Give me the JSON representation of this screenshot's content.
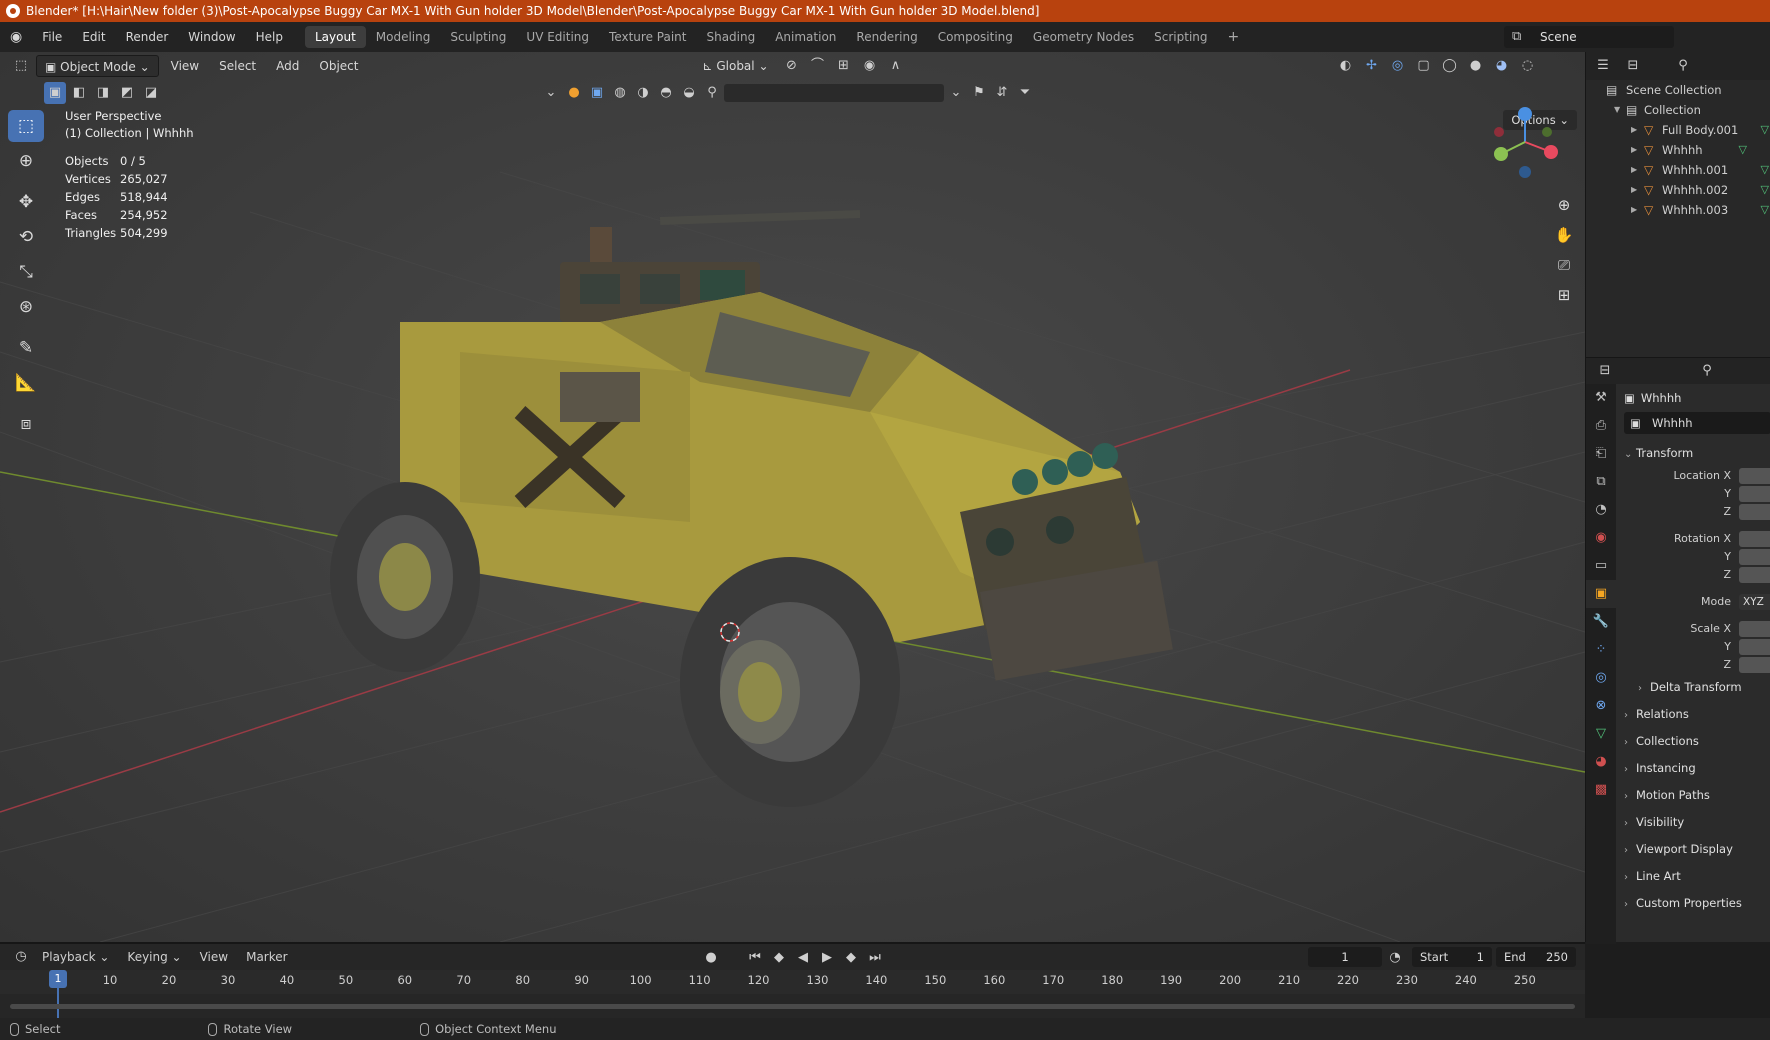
{
  "window": {
    "title": "Blender* [H:\\Hair\\New folder (3)\\Post-Apocalypse Buggy Car MX-1 With Gun holder 3D Model\\Blender\\Post-Apocalypse Buggy Car MX-1 With Gun holder 3D Model.blend]"
  },
  "menu": [
    "File",
    "Edit",
    "Render",
    "Window",
    "Help"
  ],
  "workspaces": [
    "Layout",
    "Modeling",
    "Sculpting",
    "UV Editing",
    "Texture Paint",
    "Shading",
    "Animation",
    "Rendering",
    "Compositing",
    "Geometry Nodes",
    "Scripting"
  ],
  "active_workspace": "Layout",
  "scene_name": "Scene",
  "viewport": {
    "mode": "Object Mode",
    "header_menus": [
      "View",
      "Select",
      "Add",
      "Object"
    ],
    "transform_orientation": "Global",
    "options_label": "Options",
    "perspective": "User Perspective",
    "collection_line": "(1) Collection | Whhhh",
    "stats": [
      {
        "label": "Objects",
        "value": "0 / 5"
      },
      {
        "label": "Vertices",
        "value": "265,027"
      },
      {
        "label": "Edges",
        "value": "518,944"
      },
      {
        "label": "Faces",
        "value": "254,952"
      },
      {
        "label": "Triangles",
        "value": "504,299"
      }
    ],
    "tools": [
      "select-box-icon",
      "cursor-icon",
      "move-icon",
      "rotate-icon",
      "scale-icon",
      "transform-icon",
      "annotate-icon",
      "measure-icon",
      "add-cube-icon"
    ],
    "gizmo": {
      "x_color": "#e84a5f",
      "y_color": "#8cc152",
      "z_color": "#4a90e2"
    }
  },
  "outliner": {
    "scene_collection": "Scene Collection",
    "collection": "Collection",
    "items": [
      "Full Body.001",
      "Whhhh",
      "Whhhh.001",
      "Whhhh.002",
      "Whhhh.003"
    ]
  },
  "properties": {
    "object_name": "Whhhh",
    "data_name": "Whhhh",
    "transform_label": "Transform",
    "location_labels": [
      "Location X",
      "Y",
      "Z"
    ],
    "rotation_labels": [
      "Rotation X",
      "Y",
      "Z"
    ],
    "mode_label": "Mode",
    "mode_value": "XYZ",
    "scale_labels": [
      "Scale X",
      "Y",
      "Z"
    ],
    "delta_label": "Delta Transform",
    "sections": [
      "Relations",
      "Collections",
      "Instancing",
      "Motion Paths",
      "Visibility",
      "Viewport Display",
      "Line Art",
      "Custom Properties"
    ]
  },
  "timeline": {
    "menus": [
      "Playback",
      "Keying",
      "View",
      "Marker"
    ],
    "current_frame": "1",
    "start_label": "Start",
    "start": "1",
    "end_label": "End",
    "end": "250",
    "ticks": [
      "10",
      "20",
      "30",
      "40",
      "50",
      "60",
      "70",
      "80",
      "90",
      "100",
      "110",
      "120",
      "130",
      "140",
      "150",
      "160",
      "170",
      "180",
      "190",
      "200",
      "210",
      "220",
      "230",
      "240",
      "250"
    ]
  },
  "statusbar": {
    "items": [
      "Select",
      "Rotate View",
      "Object Context Menu"
    ]
  }
}
